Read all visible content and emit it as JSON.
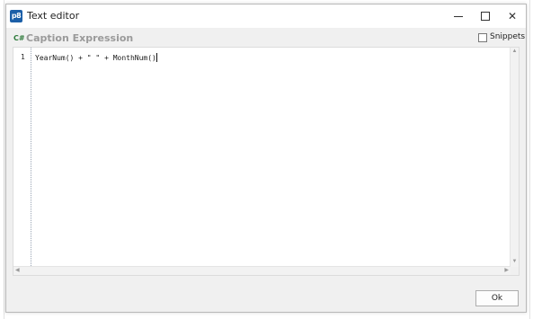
{
  "window": {
    "title": "Text editor",
    "app_icon_text": "p8",
    "controls": {
      "minimize": "minimize",
      "maximize": "maximize",
      "close": "✕"
    }
  },
  "caption": {
    "icon_text": "C#",
    "label": "Caption Expression",
    "snippets_label": "Snippets",
    "snippets_checked": false
  },
  "editor": {
    "lines": [
      {
        "number": "1",
        "code": "YearNum() + \" \" + MonthNum()"
      }
    ]
  },
  "scrollbars": {
    "up": "▲",
    "down": "▼",
    "left": "◀",
    "right": "▶"
  },
  "footer": {
    "ok_label": "Ok"
  },
  "colors": {
    "app_icon": "#1c5fa8",
    "csharp_icon": "#2d7a3a",
    "caption_label": "#9a9a9a"
  }
}
